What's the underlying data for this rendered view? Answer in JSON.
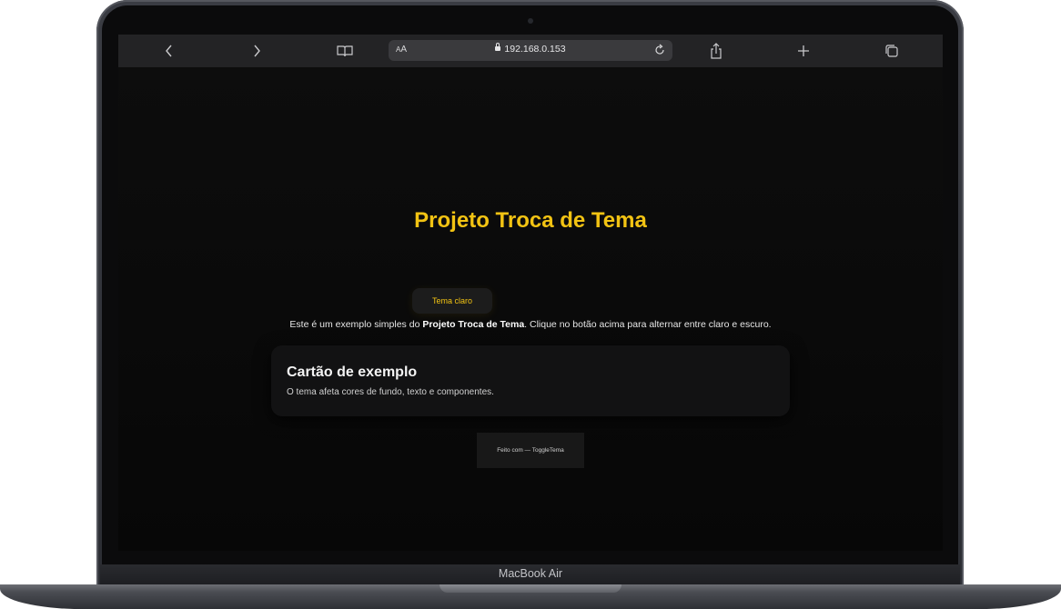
{
  "browser": {
    "text_size_label": "AA",
    "url": "192.168.0.153",
    "icons": [
      "back-icon",
      "forward-icon",
      "bookmarks-icon",
      "lock-icon",
      "reload-icon",
      "share-icon",
      "new-tab-icon",
      "tabs-icon"
    ]
  },
  "page": {
    "title": "Projeto Troca de Tema",
    "theme_button_label": "Tema claro",
    "intro_prefix": "Este é um exemplo simples do ",
    "intro_bold": "Projeto Troca de Tema",
    "intro_suffix": ". Clique no botão acima para alternar entre claro e escuro.",
    "card": {
      "title": "Cartão de exemplo",
      "text": "O tema afeta cores de fundo, texto e componentes."
    },
    "footer": "Feito com — ToggleTema"
  },
  "device": {
    "model_label": "MacBook Air"
  },
  "colors": {
    "accent": "#f2c313",
    "page_background": "#0a0a0a",
    "card_background": "#121213"
  }
}
